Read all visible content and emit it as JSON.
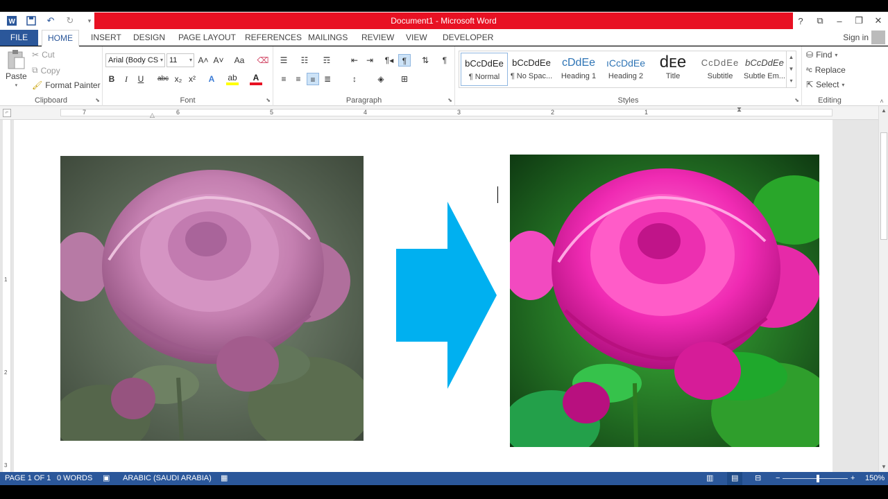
{
  "window": {
    "title": "Document1 -  Microsoft Word",
    "controls": [
      "?",
      "⧉",
      "–",
      "❐",
      "✕"
    ]
  },
  "qat": {
    "icons": [
      "word-logo-icon",
      "save-icon",
      "undo-icon",
      "redo-icon",
      "customize-icon"
    ]
  },
  "tabs": {
    "file": "FILE",
    "home": "HOME",
    "insert": "INSERT",
    "design": "DESIGN",
    "page_layout": "PAGE LAYOUT",
    "references": "REFERENCES",
    "mailings": "MAILINGS",
    "review": "REVIEW",
    "view": "VIEW",
    "developer": "DEVELOPER",
    "sign_in": "Sign in"
  },
  "ribbon": {
    "clipboard": {
      "label": "Clipboard",
      "paste": "Paste",
      "cut": "Cut",
      "copy": "Copy",
      "format_painter": "Format Painter"
    },
    "font": {
      "label": "Font",
      "font_name": "Arial (Body CS",
      "font_size": "11",
      "bold": "B",
      "italic": "I",
      "underline": "U",
      "strike": "abc",
      "subscript": "x₂",
      "superscript": "x²",
      "grow": "A˄",
      "shrink": "A˅",
      "change_case": "Aa",
      "text_effects": "A",
      "font_color": "A"
    },
    "paragraph": {
      "label": "Paragraph"
    },
    "styles": {
      "label": "Styles",
      "items": [
        {
          "preview": "bCcDdEe",
          "name": "¶ Normal"
        },
        {
          "preview": "bCcDdEe",
          "name": "¶ No Spac..."
        },
        {
          "preview": "cDdEe",
          "name": "Heading 1"
        },
        {
          "preview": "ıCcDdEe",
          "name": "Heading 2"
        },
        {
          "preview": "dᴇe",
          "name": "Title"
        },
        {
          "preview": "CcDdEe",
          "name": "Subtitle"
        },
        {
          "preview": "bCcDdEe",
          "name": "Subtle Em..."
        }
      ]
    },
    "editing": {
      "label": "Editing",
      "find": "Find",
      "replace": "Replace",
      "select": "Select"
    }
  },
  "ruler": {
    "numbers": [
      "7",
      "6",
      "5",
      "4",
      "3",
      "2",
      "1"
    ]
  },
  "vruler": {
    "numbers": [
      "1",
      "2",
      "3"
    ]
  },
  "status": {
    "page": "PAGE 1 OF 1",
    "words": "0 WORDS",
    "language": "ARABIC (SAUDI ARABIA)",
    "zoom": "150%"
  },
  "colors": {
    "accent": "#2b579a",
    "title_red": "#e81123",
    "arrow": "#00b0f0"
  }
}
